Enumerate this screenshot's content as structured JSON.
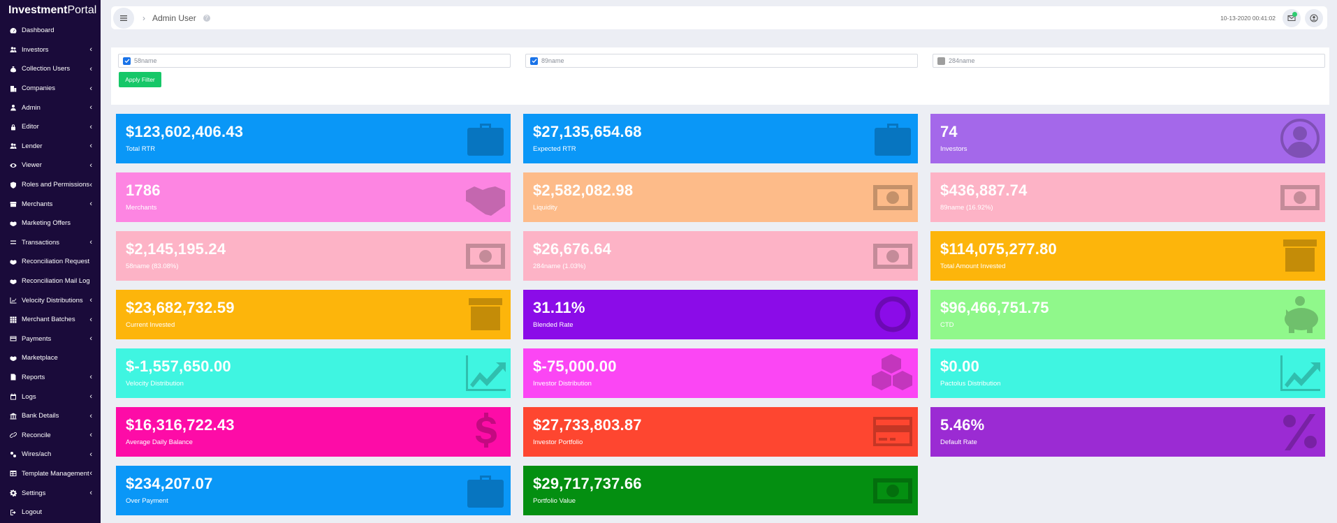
{
  "brand": {
    "bold": "Investment",
    "light": "Portal"
  },
  "sidebar": {
    "items": [
      {
        "label": "Dashboard",
        "icon": "dashboard-icon",
        "chevron": false
      },
      {
        "label": "Investors",
        "icon": "users-icon",
        "chevron": true
      },
      {
        "label": "Collection Users",
        "icon": "money-bag-icon",
        "chevron": true
      },
      {
        "label": "Companies",
        "icon": "building-icon",
        "chevron": true
      },
      {
        "label": "Admin",
        "icon": "user-icon",
        "chevron": true
      },
      {
        "label": "Editor",
        "icon": "lock-icon",
        "chevron": true
      },
      {
        "label": "Lender",
        "icon": "users-icon",
        "chevron": true
      },
      {
        "label": "Viewer",
        "icon": "eye-icon",
        "chevron": true
      },
      {
        "label": "Roles and Permissions",
        "icon": "shield-icon",
        "chevron": true
      },
      {
        "label": "Merchants",
        "icon": "store-icon",
        "chevron": true
      },
      {
        "label": "Marketing Offers",
        "icon": "handshake-icon",
        "chevron": false
      },
      {
        "label": "Transactions",
        "icon": "transfer-icon",
        "chevron": true
      },
      {
        "label": "Reconciliation Request",
        "icon": "handshake-icon",
        "chevron": false
      },
      {
        "label": "Reconciliation Mail Log",
        "icon": "handshake-icon",
        "chevron": false
      },
      {
        "label": "Velocity Distributions",
        "icon": "chart-icon",
        "chevron": true
      },
      {
        "label": "Merchant Batches",
        "icon": "grid-icon",
        "chevron": true
      },
      {
        "label": "Payments",
        "icon": "card-icon",
        "chevron": true
      },
      {
        "label": "Marketplace",
        "icon": "handshake-icon",
        "chevron": false
      },
      {
        "label": "Reports",
        "icon": "report-icon",
        "chevron": true
      },
      {
        "label": "Logs",
        "icon": "calendar-icon",
        "chevron": true
      },
      {
        "label": "Bank Details",
        "icon": "bank-icon",
        "chevron": true
      },
      {
        "label": "Reconcile",
        "icon": "link-icon",
        "chevron": true
      },
      {
        "label": "Wires/ach",
        "icon": "wire-icon",
        "chevron": true
      },
      {
        "label": "Template Management",
        "icon": "table-icon",
        "chevron": true
      },
      {
        "label": "Settings",
        "icon": "gear-icon",
        "chevron": true
      },
      {
        "label": "Logout",
        "icon": "logout-icon",
        "chevron": false
      }
    ]
  },
  "header": {
    "breadcrumb": "Admin User",
    "datetime": "10-13-2020 00:41:02",
    "help": "?"
  },
  "filters": [
    {
      "name": "58name",
      "checked": true
    },
    {
      "name": "89name",
      "checked": true
    },
    {
      "name": "284name",
      "checked": false
    }
  ],
  "apply_label": "Apply Filter",
  "chevron_glyph": "‹",
  "cards": [
    {
      "value": "$123,602,406.43",
      "label": "Total RTR",
      "color": "#0a97f7",
      "icon": "briefcase-icon"
    },
    {
      "value": "$27,135,654.68",
      "label": "Expected RTR",
      "color": "#0a97f7",
      "icon": "briefcase-icon"
    },
    {
      "value": "74",
      "label": "Investors",
      "color": "#a468ea",
      "icon": "user-circle-icon"
    },
    {
      "value": "1786",
      "label": "Merchants",
      "color": "#fd85e2",
      "icon": "handshake-icon"
    },
    {
      "value": "$2,582,082.98",
      "label": "Liquidity",
      "color": "#fdbb89",
      "icon": "money-icon"
    },
    {
      "value": "$436,887.74",
      "label": "89name (16.92%)",
      "color": "#fdb3c6",
      "icon": "money-icon"
    },
    {
      "value": "$2,145,195.24",
      "label": "58name (83.08%)",
      "color": "#fdb3c6",
      "icon": "money-icon"
    },
    {
      "value": "$26,676.64",
      "label": "284name (1.03%)",
      "color": "#fdb3c6",
      "icon": "money-icon"
    },
    {
      "value": "$114,075,277.80",
      "label": "Total Amount Invested",
      "color": "#fdb50b",
      "icon": "archive-icon"
    },
    {
      "value": "$23,682,732.59",
      "label": "Current Invested",
      "color": "#fdb50b",
      "icon": "archive-icon"
    },
    {
      "value": "31.11%",
      "label": "Blended Rate",
      "color": "#8b0ce8",
      "icon": "ring-icon"
    },
    {
      "value": "$96,466,751.75",
      "label": "CTD",
      "color": "#90f88b",
      "icon": "piggy-bank-icon"
    },
    {
      "value": "$-1,557,650.00",
      "label": "Velocity Distribution",
      "color": "#3ff5e1",
      "icon": "trend-icon"
    },
    {
      "value": "$-75,000.00",
      "label": "Investor Distribution",
      "color": "#fb46f4",
      "icon": "cubes-icon"
    },
    {
      "value": "$0.00",
      "label": "Pactolus Distribution",
      "color": "#3ff5e1",
      "icon": "trend-icon"
    },
    {
      "value": "$16,316,722.43",
      "label": "Average Daily Balance",
      "color": "#fd0ca7",
      "icon": "dollar-icon"
    },
    {
      "value": "$27,733,803.87",
      "label": "Investor Portfolio",
      "color": "#fe4630",
      "icon": "credit-card-icon"
    },
    {
      "value": "5.46%",
      "label": "Default Rate",
      "color": "#9b2bd3",
      "icon": "percent-icon"
    },
    {
      "value": "$234,207.07",
      "label": "Over Payment",
      "color": "#0a97f7",
      "icon": "briefcase-icon"
    },
    {
      "value": "$29,717,737.66",
      "label": "Portfolio Value",
      "color": "#048f11",
      "icon": "money-icon"
    }
  ]
}
